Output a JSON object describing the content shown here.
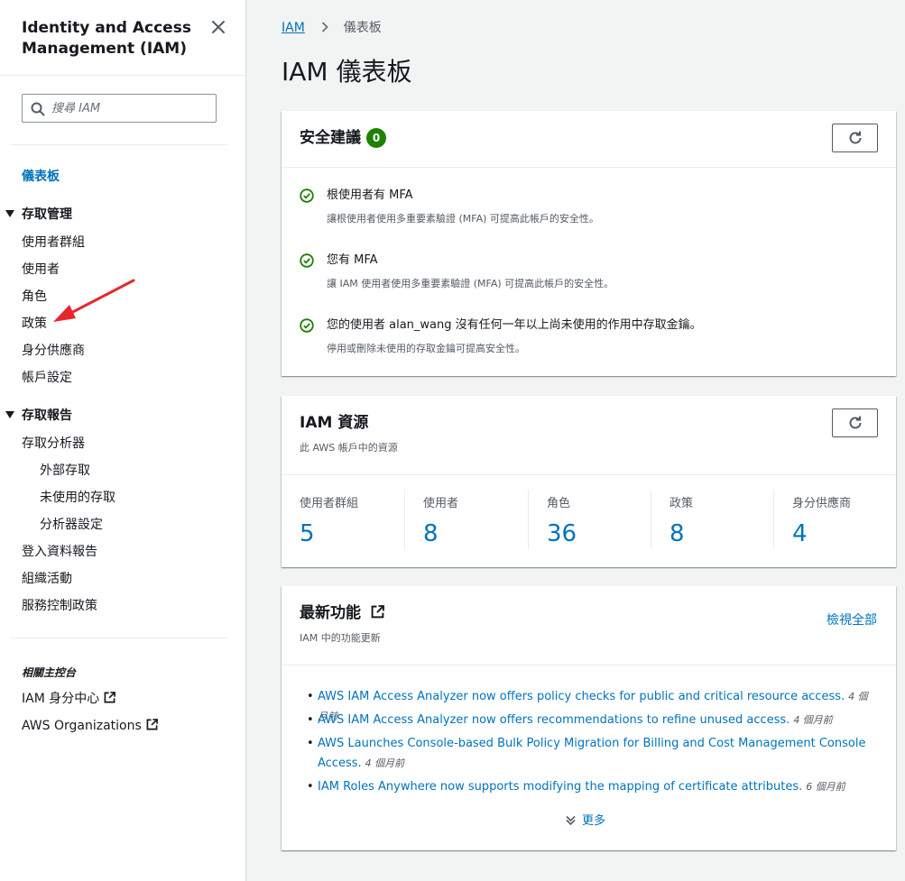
{
  "sidebar": {
    "title": "Identity and Access Management (IAM)",
    "search_placeholder": "搜尋 IAM",
    "dashboard": "儀表板",
    "access_management": {
      "label": "存取管理",
      "items": [
        "使用者群組",
        "使用者",
        "角色",
        "政策",
        "身分供應商",
        "帳戶設定"
      ]
    },
    "access_reports": {
      "label": "存取報告",
      "analyzer": "存取分析器",
      "sub_items": [
        "外部存取",
        "未使用的存取",
        "分析器設定"
      ],
      "items": [
        "登入資料報告",
        "組織活動",
        "服務控制政策"
      ]
    },
    "related": {
      "title": "相關主控台",
      "items": [
        "IAM 身分中心",
        "AWS Organizations"
      ]
    }
  },
  "breadcrumb": {
    "root": "IAM",
    "current": "儀表板"
  },
  "page_title": "IAM 儀表板",
  "security": {
    "title": "安全建議",
    "badge_count": "0",
    "items": [
      {
        "title": "根使用者有 MFA",
        "desc": "讓根使用者使用多重要素驗證 (MFA) 可提高此帳戶的安全性。"
      },
      {
        "title": "您有 MFA",
        "desc": "讓 IAM 使用者使用多重要素驗證 (MFA) 可提高此帳戶的安全性。"
      },
      {
        "title": "您的使用者 alan_wang 沒有任何一年以上尚未使用的作用中存取金鑰。",
        "desc": "停用或刪除未使用的存取金鑰可提高安全性。"
      }
    ]
  },
  "resources": {
    "title": "IAM 資源",
    "subtitle": "此 AWS 帳戶中的資源",
    "items": [
      {
        "label": "使用者群組",
        "value": "5"
      },
      {
        "label": "使用者",
        "value": "8"
      },
      {
        "label": "角色",
        "value": "36"
      },
      {
        "label": "政策",
        "value": "8"
      },
      {
        "label": "身分供應商",
        "value": "4"
      }
    ]
  },
  "features": {
    "title": "最新功能",
    "subtitle": "IAM 中的功能更新",
    "view_all": "檢視全部",
    "items": [
      {
        "text": "AWS IAM Access Analyzer now offers policy checks for public and critical resource access.",
        "age": "4 個月前"
      },
      {
        "text": "AWS IAM Access Analyzer now offers recommendations to refine unused access.",
        "age": "4 個月前"
      },
      {
        "text": "AWS Launches Console-based Bulk Policy Migration for Billing and Cost Management Console Access.",
        "age": "4 個月前"
      },
      {
        "text": "IAM Roles Anywhere now supports modifying the mapping of certificate attributes.",
        "age": "6 個月前"
      }
    ],
    "more": "更多"
  },
  "colors": {
    "link": "#0073bb",
    "success": "#1d8102",
    "annotation_arrow": "#e8262d"
  }
}
